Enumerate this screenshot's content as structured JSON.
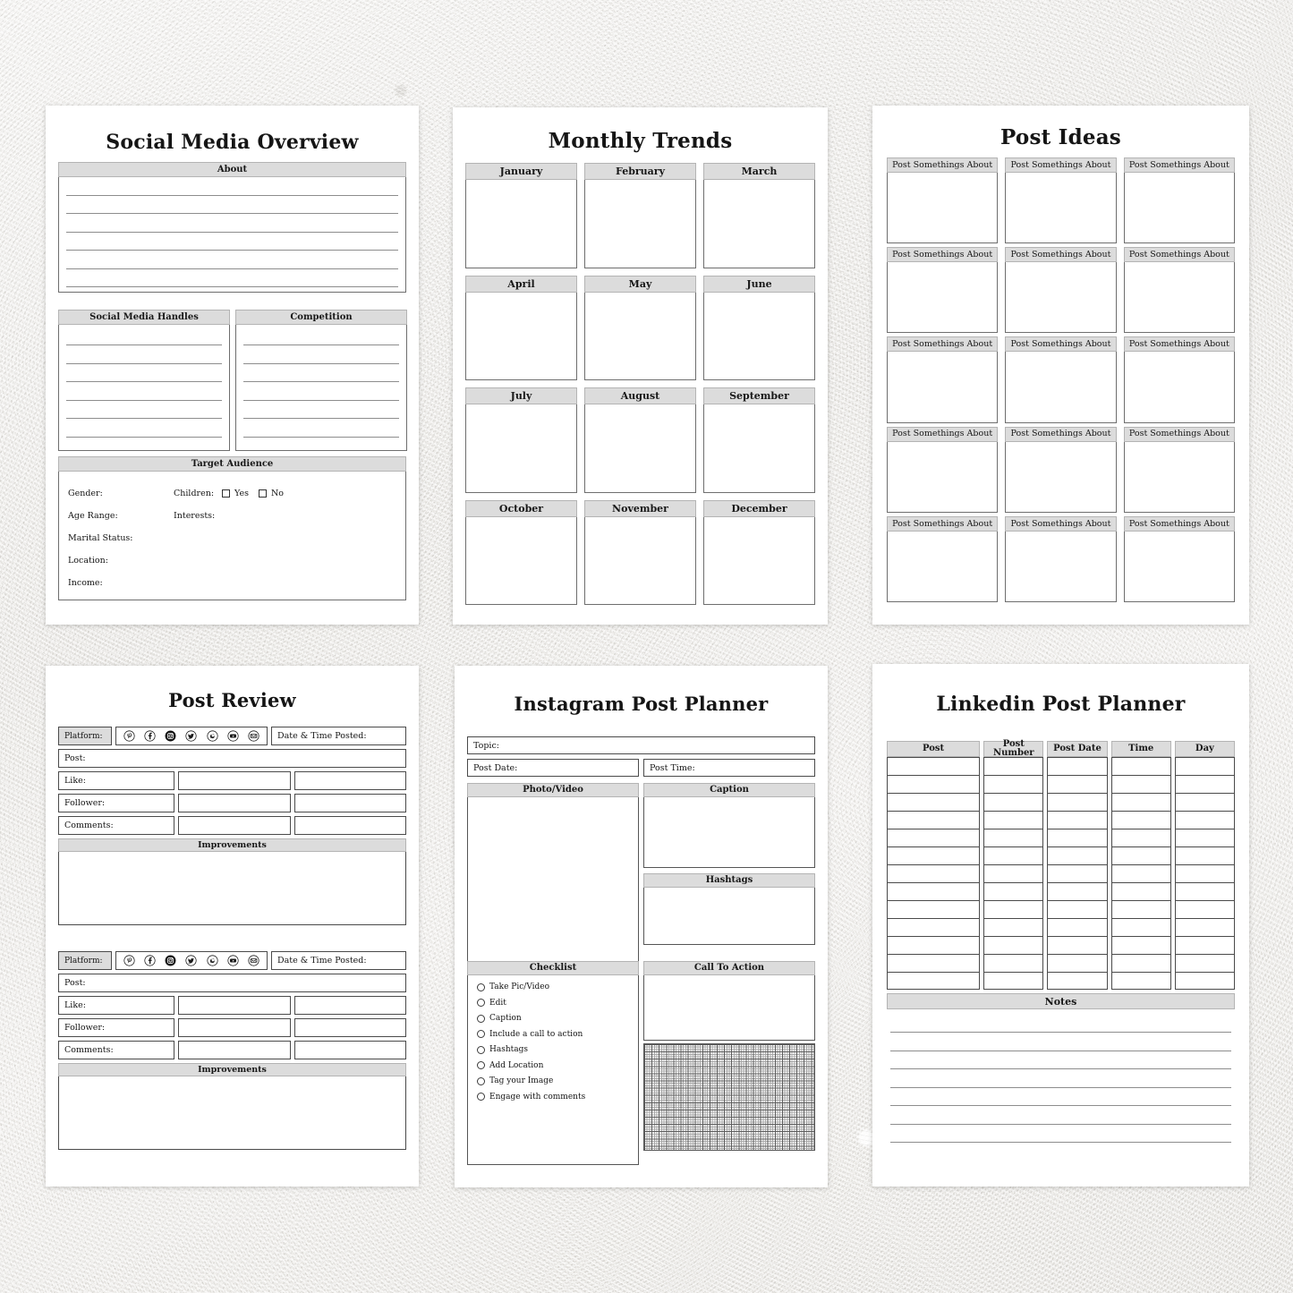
{
  "background": {
    "color": "#eae8e4",
    "texture": "stone"
  },
  "theme": {
    "header_fill": "#dcdcdc",
    "header_border": "#b4b4b4",
    "box_border": "#6e6e6e",
    "ink": "#151515",
    "sheet": "#ffffff"
  },
  "pages": [
    {
      "id": "social-media-overview",
      "title": "Social Media Overview",
      "sections": {
        "about": {
          "label": "About",
          "lines": 6
        },
        "handles": {
          "label": "Social Media Handles",
          "lines": 6
        },
        "competition": {
          "label": "Competition",
          "lines": 6
        },
        "target_audience": {
          "label": "Target Audience",
          "left_fields": [
            "Gender:",
            "Age Range:",
            "Marital Status:",
            "Location:",
            "Income:"
          ],
          "right_fields": [
            "Children:",
            "Interests:"
          ],
          "children_options": [
            "Yes",
            "No"
          ]
        }
      }
    },
    {
      "id": "monthly-trends",
      "title": "Monthly Trends",
      "months": [
        "January",
        "February",
        "March",
        "April",
        "May",
        "June",
        "July",
        "August",
        "September",
        "October",
        "November",
        "December"
      ]
    },
    {
      "id": "post-ideas",
      "title": "Post Ideas",
      "cell_label": "Post Somethings About",
      "rows": 5,
      "columns": 3,
      "cells": [
        "Post Somethings About",
        "Post Somethings About",
        "Post Somethings About",
        "Post Somethings About",
        "Post Somethings About",
        "Post Somethings About",
        "Post Somethings About",
        "Post Somethings About",
        "Post Somethings About",
        "Post Somethings About",
        "Post Somethings About",
        "Post Somethings About",
        "Post Somethings About",
        "Post Somethings About",
        "Post Somethings About"
      ]
    },
    {
      "id": "post-review",
      "title": "Post Review",
      "platform_label": "Platform:",
      "platform_icons": [
        "pinterest-icon",
        "facebook-icon",
        "instagram-icon",
        "twitter-icon",
        "whatsapp-icon",
        "youtube-icon",
        "email-icon"
      ],
      "date_time_label": "Date & Time Posted:",
      "post_label": "Post:",
      "metric_rows": [
        "Like:",
        "Follower:",
        "Comments:"
      ],
      "improvements_label": "Improvements",
      "entries": 2
    },
    {
      "id": "instagram-post-planner",
      "title": "Instagram Post Planner",
      "topic_label": "Topic:",
      "post_date_label": "Post Date:",
      "post_time_label": "Post Time:",
      "photo_video_label": "Photo/Video",
      "caption_label": "Caption",
      "hashtags_label": "Hashtags",
      "checklist_label": "Checklist",
      "checklist_items": [
        "Take Pic/Video",
        "Edit",
        "Caption",
        "Include a call to action",
        "Hashtags",
        "Add Location",
        "Tag your Image",
        "Engage with comments"
      ],
      "call_to_action_label": "Call To Action",
      "grid_sketch_area": "graph-paper"
    },
    {
      "id": "linkedin-post-planner",
      "title": "Linkedin Post Planner",
      "table_headers": [
        "Post",
        "Post Number",
        "Post Date",
        "Time",
        "Day"
      ],
      "table_rows": 13,
      "notes_label": "Notes",
      "notes_lines": 7
    }
  ]
}
